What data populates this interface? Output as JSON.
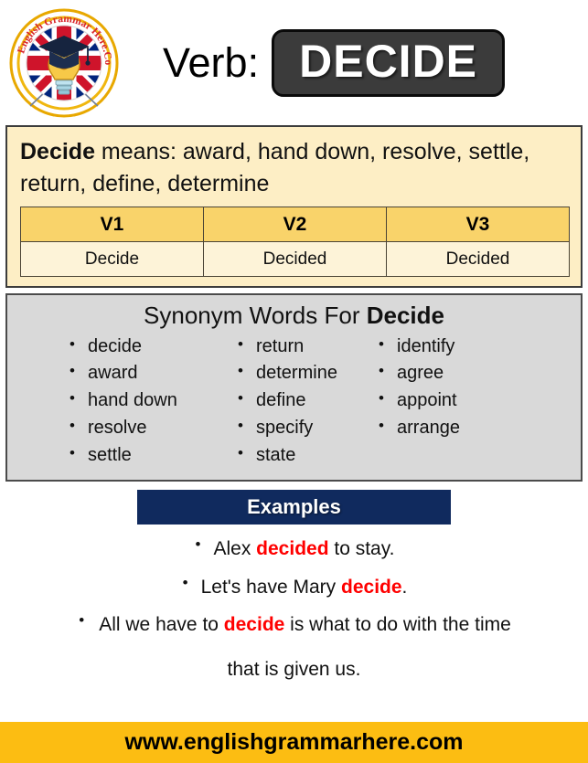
{
  "header": {
    "logo_alt": "English Grammar Here.Com",
    "logo_text_top": "English Grammar",
    "logo_text_bottom": "Here.Com",
    "verb_label": "Verb:",
    "verb_word": "DECIDE"
  },
  "meaning": {
    "word": "Decide",
    "lead": " means: ",
    "definition": "award, hand down, resolve, settle, return, define, determine",
    "table": {
      "headers": [
        "V1",
        "V2",
        "V3"
      ],
      "row": [
        "Decide",
        "Decided",
        "Decided"
      ]
    }
  },
  "synonyms": {
    "title_prefix": "Synonym Words For ",
    "title_word": "Decide",
    "columns": [
      [
        "decide",
        "award",
        "hand down",
        "resolve",
        "settle"
      ],
      [
        "return",
        "determine",
        "define",
        "specify",
        "state"
      ],
      [
        "identify",
        "agree",
        "appoint",
        "arrange"
      ]
    ]
  },
  "examples": {
    "title": "Examples",
    "items": [
      {
        "pre": "Alex ",
        "kw": "decided",
        "post": " to stay."
      },
      {
        "pre": "Let's have Mary ",
        "kw": "decide",
        "post": "."
      },
      {
        "pre": "All we have to ",
        "kw": "decide",
        "post": " is what to do with the time",
        "line2": "that is given us."
      }
    ]
  },
  "footer": {
    "url": "www.englishgrammarhere.com"
  },
  "colors": {
    "verb_box_bg": "#3b3b3b",
    "meaning_bg": "#fdeec5",
    "table_header_bg": "#f9d36a",
    "table_cell_bg": "#fdf3d8",
    "synonym_bg": "#d9d9d9",
    "examples_bar_bg": "#102a5e",
    "footer_bg": "#fcbd12",
    "keyword_red": "#ff0000"
  }
}
